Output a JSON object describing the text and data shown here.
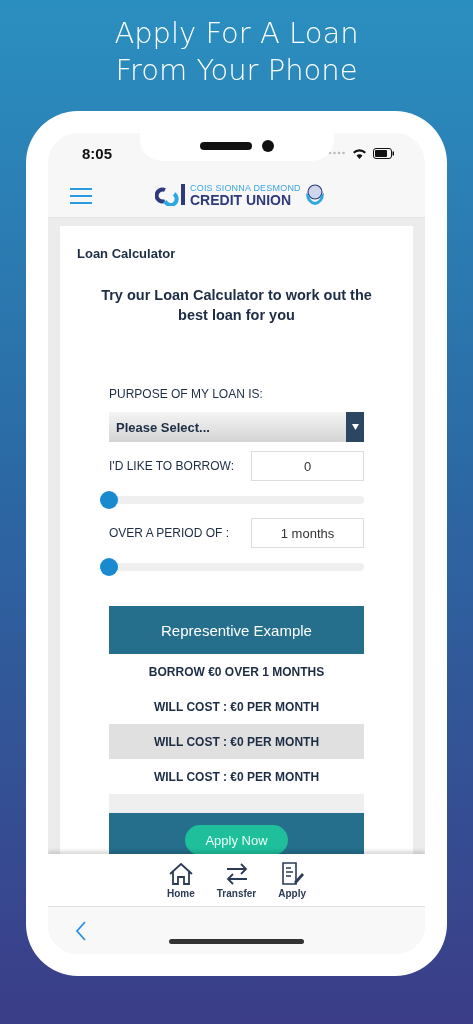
{
  "headline": [
    "Apply For A Loan",
    "From Your Phone"
  ],
  "status_bar": {
    "time": "8:05"
  },
  "header": {
    "logo_top": "COIS SIONNA DESMOND",
    "logo_bottom": "CREDIT UNION"
  },
  "page_title": "Loan Calculator",
  "intro": "Try our Loan Calculator to work out the best loan for you",
  "purpose": {
    "label": "PURPOSE OF MY LOAN IS:",
    "value": "Please Select..."
  },
  "amount": {
    "label": "I'D LIKE TO BORROW:",
    "value": "0",
    "level": 0
  },
  "period": {
    "label": "OVER A PERIOD OF :",
    "value": "1 months",
    "level": 0
  },
  "example": {
    "title": "Representive Example",
    "rows": [
      {
        "text": "BORROW €0 OVER 1 MONTHS",
        "shaded": false
      },
      {
        "text": "WILL COST : €0 PER MONTH",
        "shaded": false
      },
      {
        "text": "WILL COST : €0 PER MONTH",
        "shaded": true
      },
      {
        "text": "WILL COST : €0 PER MONTH",
        "shaded": false
      }
    ]
  },
  "apply_button": "Apply Now",
  "tabs": [
    {
      "label": "Home",
      "kind": "home"
    },
    {
      "label": "Transfer",
      "kind": "transfer"
    },
    {
      "label": "Apply",
      "kind": "apply"
    }
  ]
}
